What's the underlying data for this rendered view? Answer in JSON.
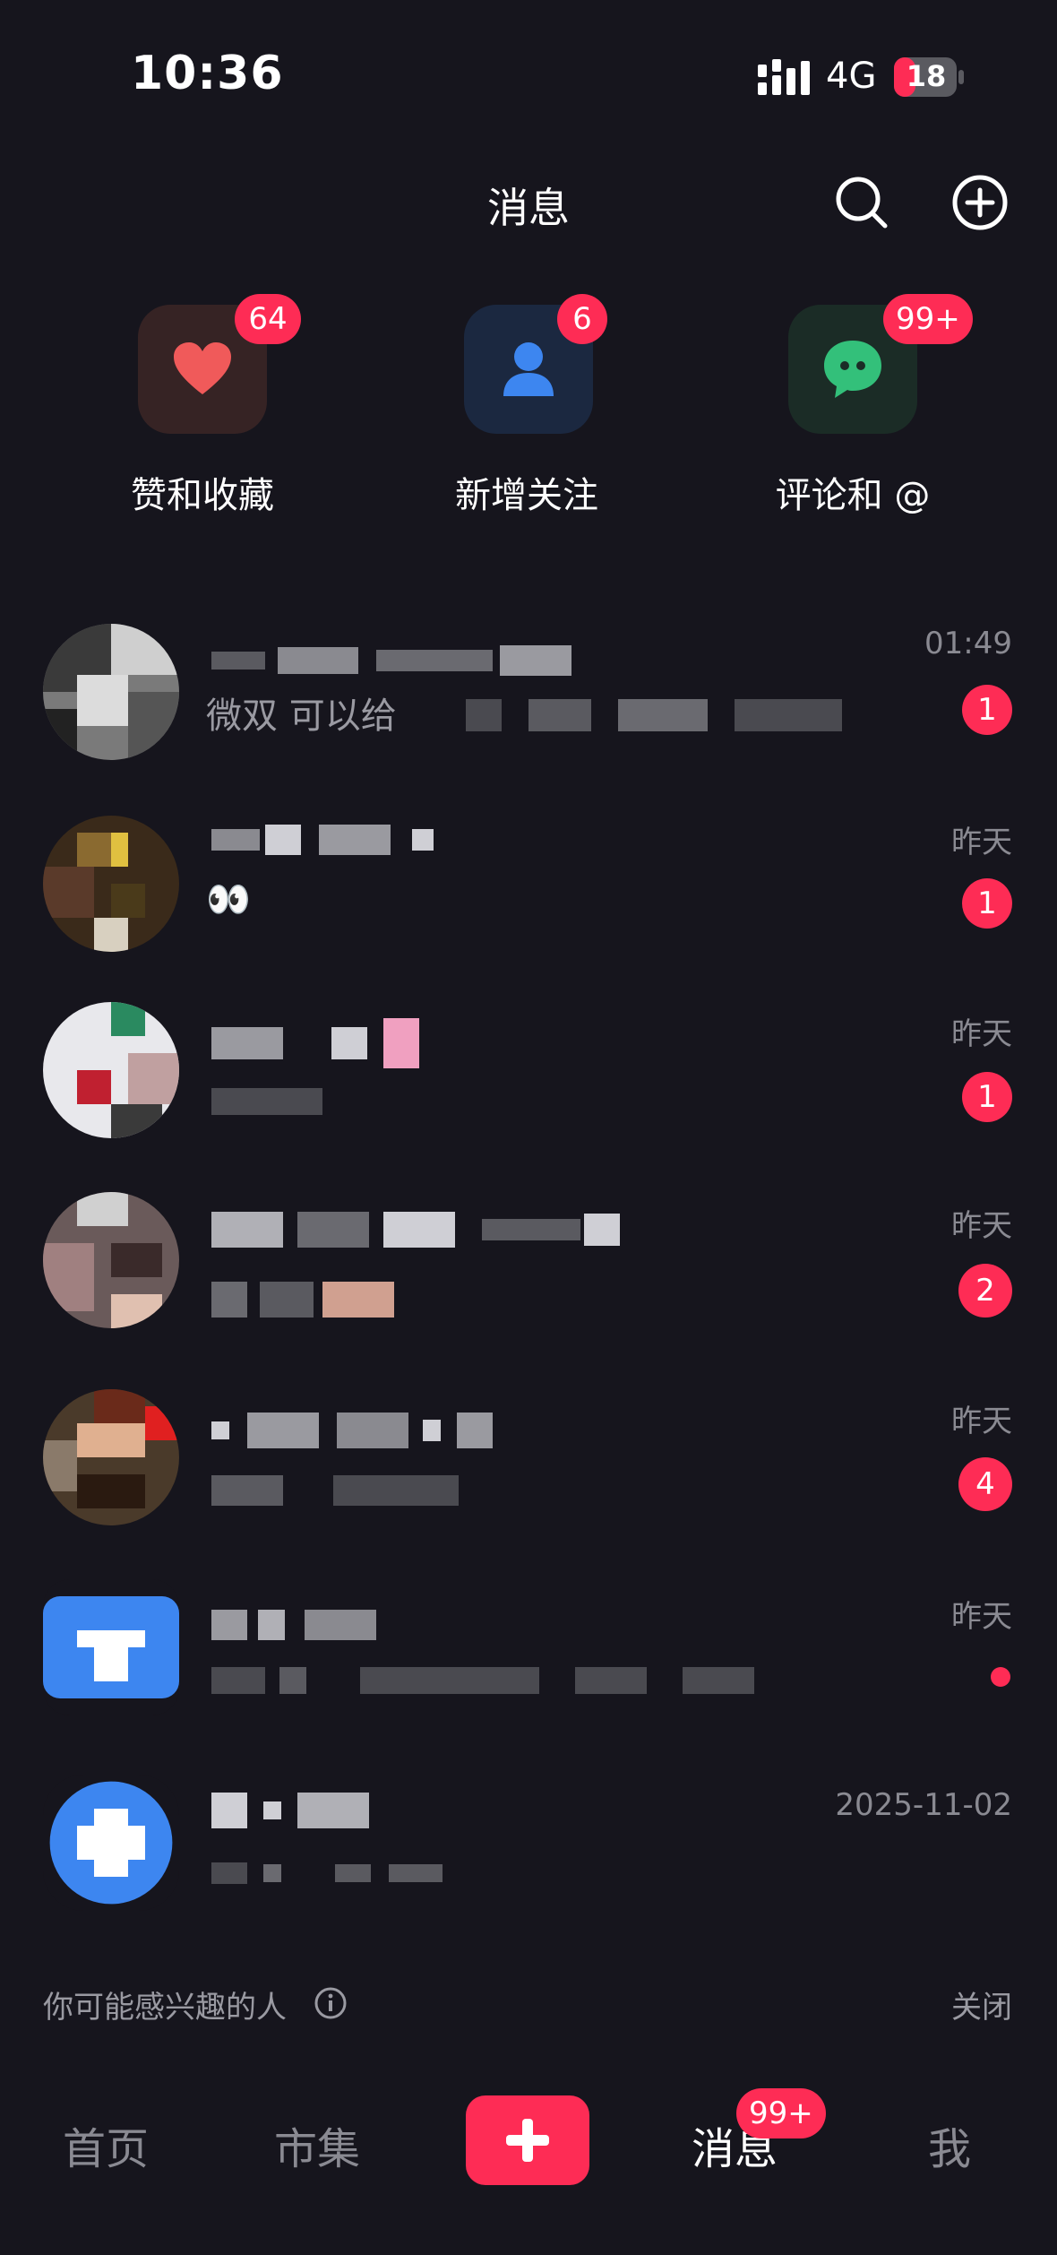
{
  "status_bar": {
    "time": "10:36",
    "network": "4G",
    "battery": "18"
  },
  "header": {
    "title": "消息",
    "icons": [
      "search-icon",
      "plus-circle-icon"
    ]
  },
  "quick_tiles": [
    {
      "label": "赞和收藏",
      "badge": "64",
      "icon": "heart-icon",
      "color": "#f05a5a"
    },
    {
      "label": "新增关注",
      "badge": "6",
      "icon": "person-icon",
      "color": "#3d86f0"
    },
    {
      "label": "评论和 @",
      "badge": "99+",
      "icon": "chat-bubble-icon",
      "color": "#33c07a"
    }
  ],
  "chats": [
    {
      "time": "01:49",
      "unread": "1",
      "message": "微双 可以给"
    },
    {
      "time": "昨天",
      "unread": "1",
      "message": "👀"
    },
    {
      "time": "昨天",
      "unread": "1"
    },
    {
      "time": "昨天",
      "unread": "2"
    },
    {
      "time": "昨天",
      "unread": "4"
    },
    {
      "time": "昨天",
      "unread": ""
    },
    {
      "time": "2025-11-02",
      "unread": ""
    }
  ],
  "suggestion": {
    "label": "你可能感兴趣的人",
    "close": "关闭"
  },
  "tab_bar": {
    "home": "首页",
    "market": "市集",
    "messages": "消息",
    "messages_badge": "99+",
    "me": "我"
  },
  "colors": {
    "background": "#16151d",
    "accent": "#fe2c55"
  }
}
